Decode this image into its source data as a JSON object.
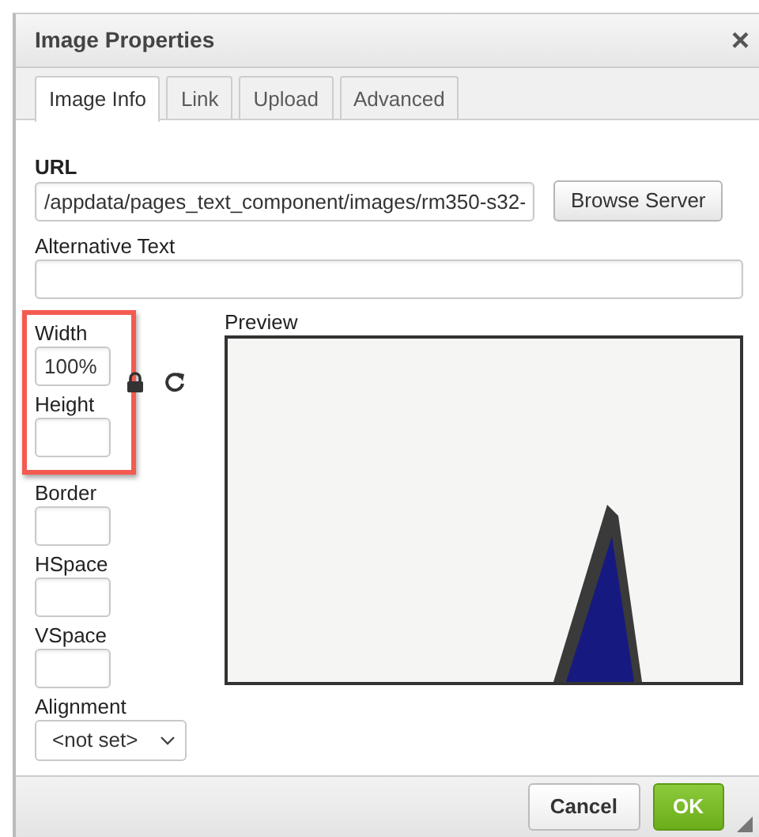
{
  "dialog": {
    "title": "Image Properties",
    "close": "×"
  },
  "tabs": [
    {
      "label": "Image Info",
      "selected": true
    },
    {
      "label": "Link",
      "selected": false
    },
    {
      "label": "Upload",
      "selected": false
    },
    {
      "label": "Advanced",
      "selected": false
    }
  ],
  "url": {
    "label": "URL",
    "value": "/appdata/pages_text_component/images/rm350-s32-",
    "button": "Browse Server"
  },
  "alt_text": {
    "label": "Alternative Text"
  },
  "size": {
    "highlighted": true,
    "fields": [
      {
        "label": "Width",
        "value": "100%"
      },
      {
        "label": "Height"
      }
    ]
  },
  "spacing": [
    {
      "label": "Border"
    },
    {
      "label": "HSpace"
    },
    {
      "label": "VSpace"
    }
  ],
  "alignment": {
    "label": "Alignment",
    "value": "<not set>"
  },
  "preview": {
    "label": "Preview"
  },
  "buttons": [
    {
      "label": "Cancel",
      "kind": "secondary"
    },
    {
      "label": "OK",
      "kind": "primary"
    }
  ]
}
